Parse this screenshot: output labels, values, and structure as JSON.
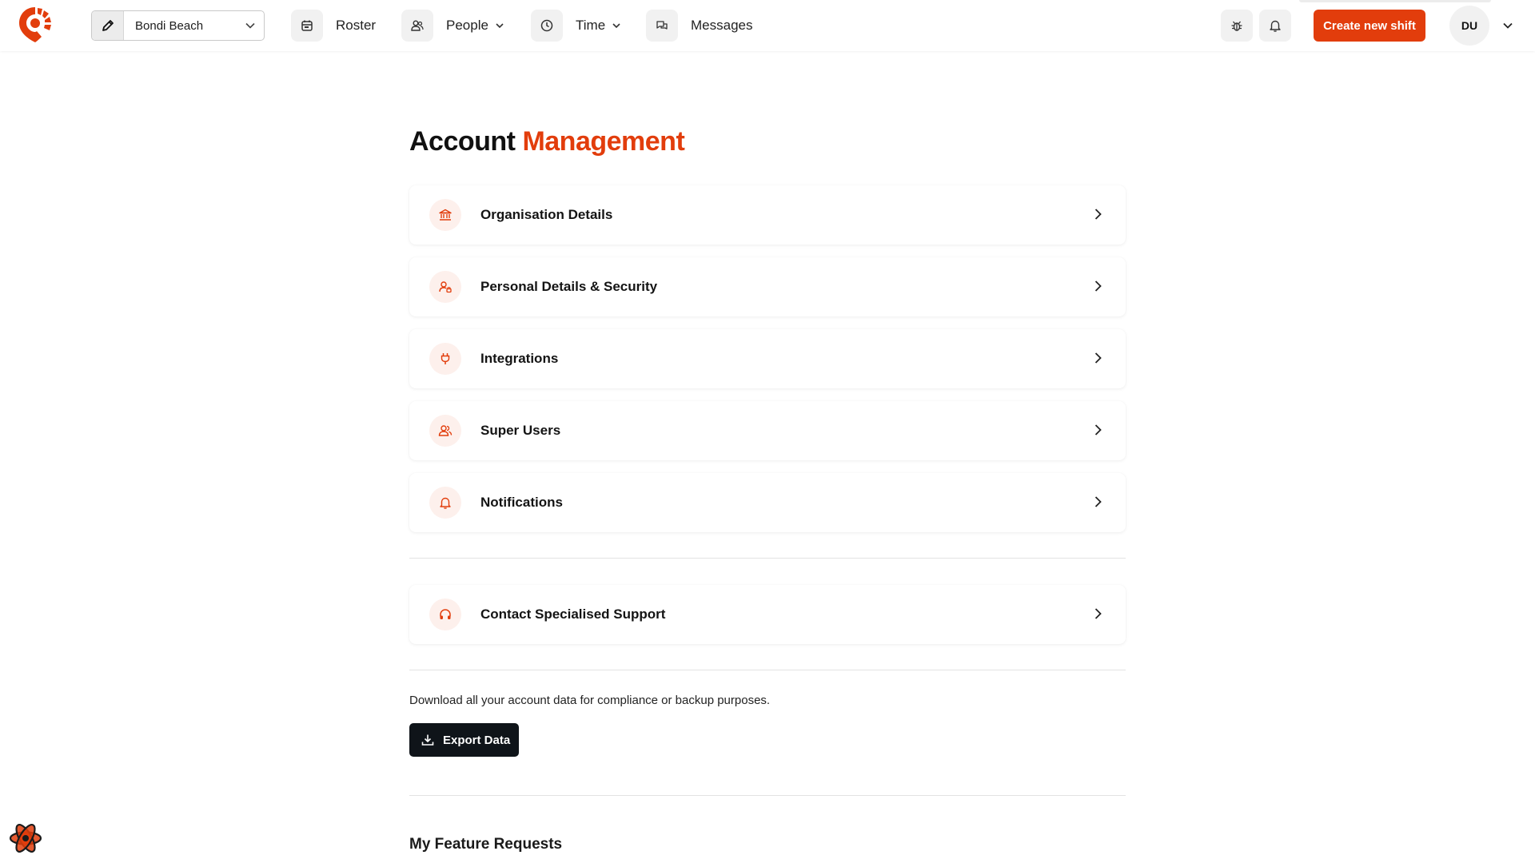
{
  "app": {
    "brand_color": "#e23d0c",
    "logo_icon": "brand-logo-icon"
  },
  "topbar": {
    "location": {
      "label": "Bondi Beach",
      "edit_icon": "pencil-icon",
      "chevron_icon": "chevron-down-icon"
    },
    "nav": [
      {
        "label": "Roster",
        "icon": "calendar-icon"
      },
      {
        "label": "People",
        "icon": "people-icon",
        "has_dropdown": true
      },
      {
        "label": "Time",
        "icon": "clock-icon",
        "has_dropdown": true
      },
      {
        "label": "Messages",
        "icon": "chat-icon"
      }
    ],
    "bug_icon": "bug-icon",
    "bell_icon": "bell-icon",
    "create_button": "Create new shift",
    "avatar_initials": "DU"
  },
  "page": {
    "title_part1": "Account",
    "title_part2": "Management",
    "cards": [
      {
        "label": "Organisation Details",
        "icon": "bank-icon"
      },
      {
        "label": "Personal Details & Security",
        "icon": "user-lock-icon"
      },
      {
        "label": "Integrations",
        "icon": "plug-icon"
      },
      {
        "label": "Super Users",
        "icon": "user-group-icon"
      },
      {
        "label": "Notifications",
        "icon": "bell-icon"
      }
    ],
    "support_card": {
      "label": "Contact Specialised Support",
      "icon": "headphones-icon"
    },
    "export": {
      "description": "Download all your account data for compliance or backup purposes.",
      "button": "Export Data",
      "icon": "download-icon"
    },
    "feature_requests_title": "My Feature Requests"
  }
}
